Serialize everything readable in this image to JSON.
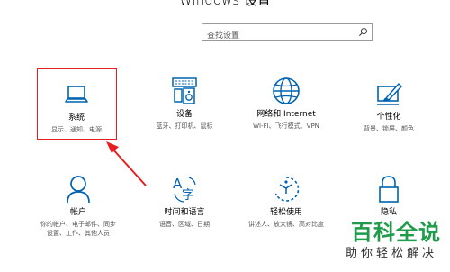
{
  "window": {
    "title": "Windows 设置"
  },
  "search": {
    "placeholder": "查找设置"
  },
  "tiles": [
    {
      "name": "系统",
      "desc": "显示、通知、电源",
      "icon": "laptop-icon"
    },
    {
      "name": "设备",
      "desc": "蓝牙、打印机、鼠标",
      "icon": "keyboard-speaker-icon"
    },
    {
      "name": "网络和 Internet",
      "desc": "WI-FI、飞行模式、VPN",
      "icon": "globe-icon"
    },
    {
      "name": "个性化",
      "desc": "背景、锁屏、颜色",
      "icon": "paint-brush-icon"
    },
    {
      "name": "帐户",
      "desc_line1": "你的帐户、电子邮件、同步",
      "desc_line2": "设置、工作、其他人员",
      "icon": "person-icon"
    },
    {
      "name": "时间和语言",
      "desc": "语音、区域、日期",
      "icon": "language-time-icon"
    },
    {
      "name": "轻松使用",
      "desc": "讲述人、放大镜、高对比度",
      "icon": "ease-of-access-icon"
    },
    {
      "name": "隐私",
      "desc": "",
      "icon": "lock-icon"
    }
  ],
  "colors": {
    "accent": "#0063b1",
    "highlight": "#e81e1e",
    "watermark_green": "#1f9b4b"
  },
  "watermark": {
    "main": "百科全说",
    "sub": "助你轻松解决"
  }
}
